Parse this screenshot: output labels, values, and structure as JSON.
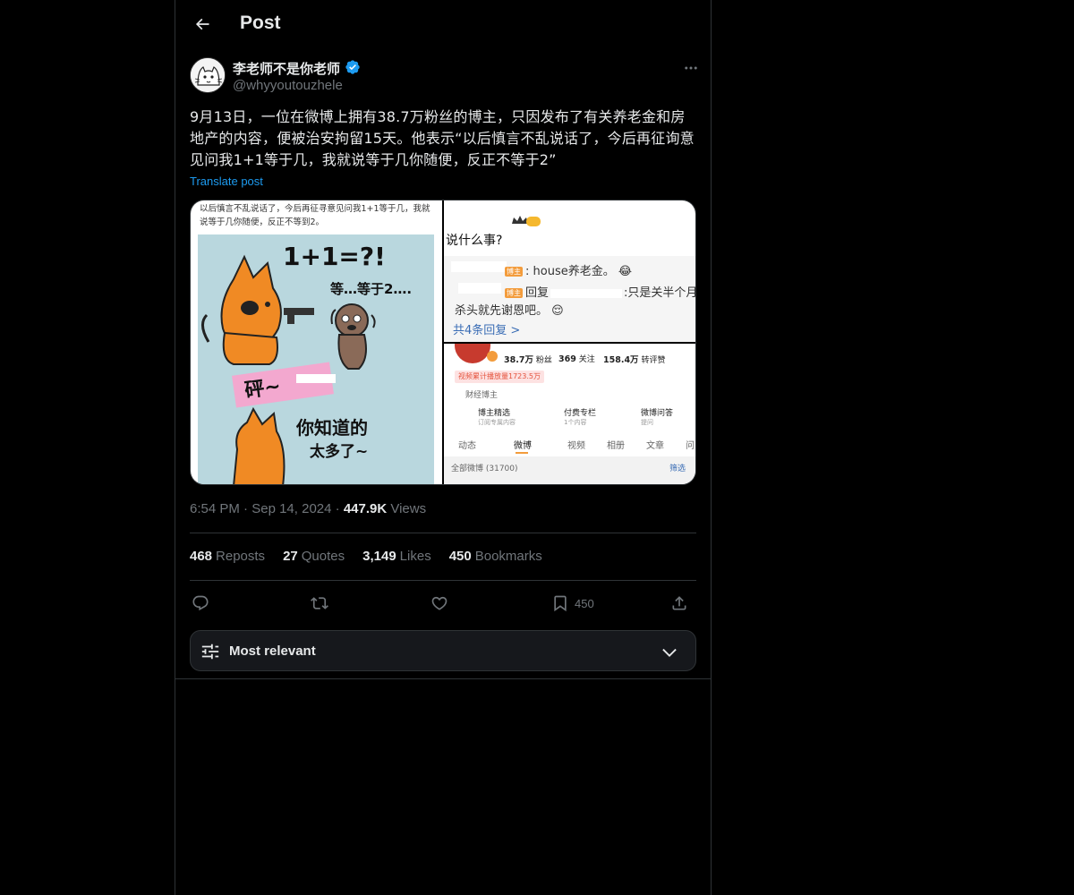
{
  "header": {
    "title": "Post"
  },
  "author": {
    "name": "李老师不是你老师",
    "handle": "@whyyoutouzhele",
    "verified": true
  },
  "post": {
    "text": "9月13日，一位在微博上拥有38.7万粉丝的博主，只因发布了有关养老金和房地产的内容，便被治安拘留15天。他表示“以后慎言不乱说话了，今后再征询意见问我1+1等于几，我就说等于几你随便，反正不等于2”",
    "translate_label": "Translate post"
  },
  "media": {
    "left_image": {
      "caption": "以后慎言不乱说话了，今后再征寻意见问我1+1等于几，我就说等于几你随便，反正不等到2。",
      "comic_equation": "1+1=?!",
      "comic_dog_text": "等…等于2….",
      "comic_bang": "砰~",
      "comic_bottom": "你知道的",
      "comic_bottom2": "太多了~"
    },
    "top_right_image": {
      "title": "说什么事?",
      "reply1_tag": "博主",
      "reply1": ": house养老金。",
      "reply2_tag": "博主",
      "reply2_prefix": "回复",
      "reply2": ":只是关半个月",
      "reply2_line2": "杀头就先谢恩吧。",
      "more_replies": "共4条回复 >"
    },
    "bottom_right_image": {
      "fans": "38.7万",
      "fans_label": "粉丝",
      "following": "369",
      "following_label": "关注",
      "likes": "158.4万",
      "likes_label": "转评赞",
      "video_plays": "视频累计播放量1723.5万",
      "category": "财经博主",
      "tools": [
        {
          "label": "博主精选",
          "sub": "订阅专属内容"
        },
        {
          "label": "付费专栏",
          "sub": "1个内容"
        },
        {
          "label": "微博问答",
          "sub": "提问"
        }
      ],
      "tabs": [
        "动态",
        "微博",
        "视频",
        "相册",
        "文章",
        "问"
      ],
      "all_posts": "全部微博 (31700)",
      "filter": "筛选"
    }
  },
  "meta": {
    "time": "6:54 PM",
    "date": "Sep 14, 2024",
    "views": "447.9K",
    "views_label": "Views"
  },
  "stats": {
    "reposts": "468",
    "reposts_label": "Reposts",
    "quotes": "27",
    "quotes_label": "Quotes",
    "likes": "3,149",
    "likes_label": "Likes",
    "bookmarks": "450",
    "bookmarks_label": "Bookmarks"
  },
  "actions": {
    "bookmark_count": "450"
  },
  "sort": {
    "label": "Most relevant"
  },
  "colors": {
    "accent": "#1d9bf0",
    "background": "#000000",
    "border": "#2f3336",
    "muted": "#71767b"
  }
}
